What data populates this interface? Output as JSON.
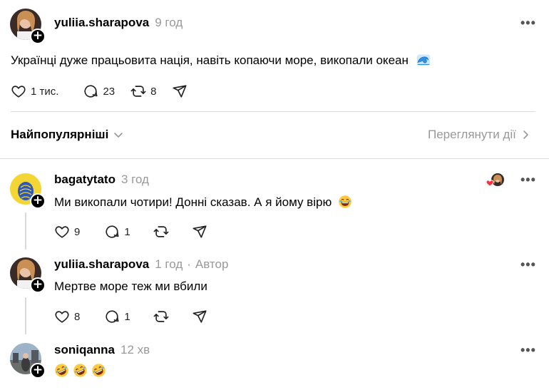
{
  "post": {
    "username": "yuliia.sharapova",
    "time": "9 год",
    "text": "Українці дуже працьовита нація, навіть копаючи море, викопали океан",
    "likes": "1 тис.",
    "comments": "23",
    "reposts": "8"
  },
  "sort": {
    "label": "Найпопулярніші",
    "view_activity": "Переглянути дії"
  },
  "replies": [
    {
      "username": "bagatytato",
      "time": "3 год",
      "text": "Ми викопали чотири! Донні сказав. А я йому вірю",
      "likes": "9",
      "comments": "1"
    },
    {
      "username": "yuliia.sharapova",
      "time": "1 год",
      "author_badge": "Автор",
      "separator": "·",
      "text": "Мертве море теж ми вбили",
      "likes": "8",
      "comments": "1"
    },
    {
      "username": "soniqanna",
      "time": "12 хв"
    }
  ],
  "icons": {
    "more": "more-dots-icon",
    "like": "heart-icon",
    "comment": "comment-bubble-icon",
    "repost": "repost-icon",
    "share": "share-paper-plane-icon",
    "wave": "wave-emoji-icon",
    "laugh": "laughing-emoji-icon",
    "rofl": "rofl-emoji-icon"
  },
  "colors": {
    "muted": "#999999",
    "divider": "#dcdcdc",
    "like_red": "#ff3040"
  }
}
